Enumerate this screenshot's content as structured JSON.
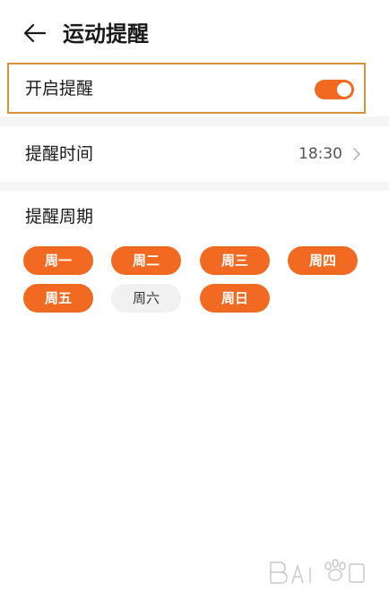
{
  "header": {
    "title": "运动提醒",
    "back_icon": "arrow-left-icon"
  },
  "toggle": {
    "label": "开启提醒",
    "on": true,
    "accent": "#f26a21",
    "highlight_border": "#d6923d"
  },
  "reminder_time": {
    "label": "提醒时间",
    "value": "18:30",
    "chevron_icon": "chevron-right-icon"
  },
  "cycle": {
    "label": "提醒周期",
    "days": [
      {
        "label": "周一",
        "selected": true
      },
      {
        "label": "周二",
        "selected": true
      },
      {
        "label": "周三",
        "selected": true
      },
      {
        "label": "周四",
        "selected": true
      },
      {
        "label": "周五",
        "selected": true
      },
      {
        "label": "周六",
        "selected": false
      },
      {
        "label": "周日",
        "selected": true
      }
    ]
  },
  "watermark": {
    "icon": "baidu-paw-logo-icon"
  }
}
